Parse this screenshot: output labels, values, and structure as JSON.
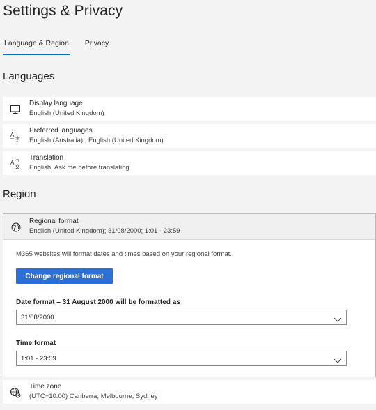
{
  "page": {
    "title": "Settings & Privacy"
  },
  "tabs": [
    {
      "label": "Language & Region",
      "active": true
    },
    {
      "label": "Privacy",
      "active": false
    }
  ],
  "languages": {
    "heading": "Languages",
    "items": [
      {
        "icon": "monitor-icon",
        "label": "Display language",
        "value": "English (United Kingdom)"
      },
      {
        "icon": "preferred-languages-icon",
        "label": "Preferred languages",
        "value": "English (Australia) ; English (United Kingdom)"
      },
      {
        "icon": "translation-icon",
        "label": "Translation",
        "value": "English, Ask me before translating"
      }
    ]
  },
  "region": {
    "heading": "Region",
    "regional_format": {
      "icon": "globe-icon",
      "label": "Regional format",
      "value": "English (United Kingdom); 31/08/2000; 1:01 - 23:59",
      "description": "M365 websites will format dates and times based on your regional format.",
      "change_button": "Change regional format",
      "date_format_label": "Date format – 31 August 2000 will be formatted as",
      "date_format_value": "31/08/2000",
      "time_format_label": "Time format",
      "time_format_value": "1:01 - 23:59"
    },
    "time_zone": {
      "icon": "globe-clock-icon",
      "label": "Time zone",
      "value": "(UTC+10:00) Canberra, Melbourne, Sydney"
    }
  },
  "colors": {
    "accent": "#0f6cbd",
    "primary_button": "#2b70d9",
    "background": "#f3f3f3",
    "card": "#ffffff"
  }
}
